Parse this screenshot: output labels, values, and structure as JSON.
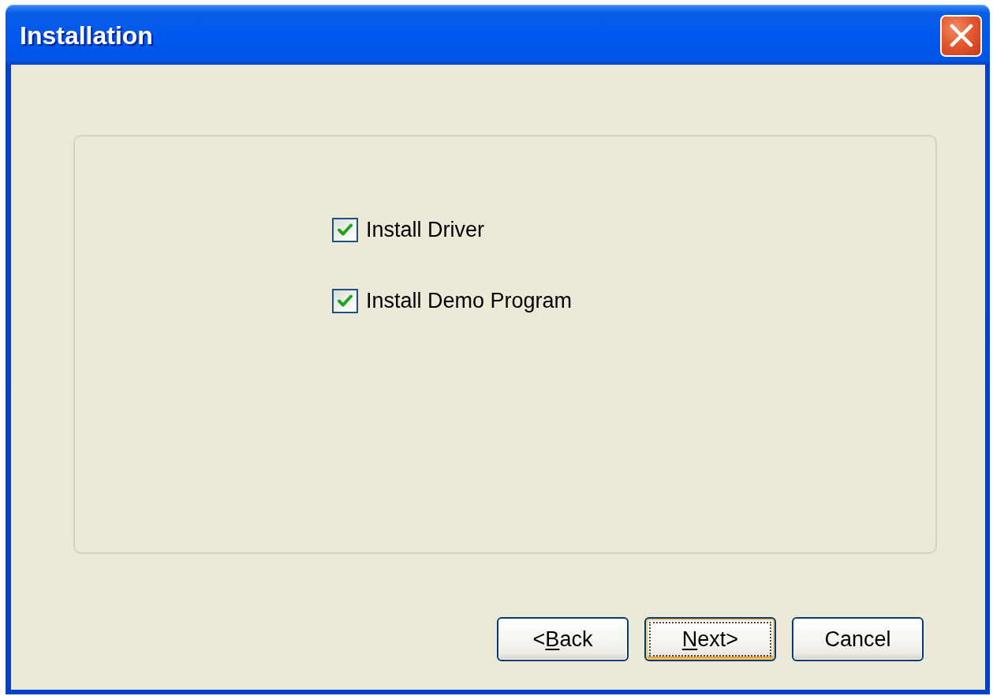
{
  "window": {
    "title": "Installation"
  },
  "options": [
    {
      "label": "Install Driver",
      "checked": true
    },
    {
      "label": "Install Demo Program",
      "checked": true
    }
  ],
  "buttons": [
    {
      "label": "<Back",
      "key_underlined": true,
      "focused": false
    },
    {
      "label": "Next>",
      "key_underlined": true,
      "focused": true
    },
    {
      "label": "Cancel",
      "key_underlined": false,
      "focused": false
    }
  ]
}
